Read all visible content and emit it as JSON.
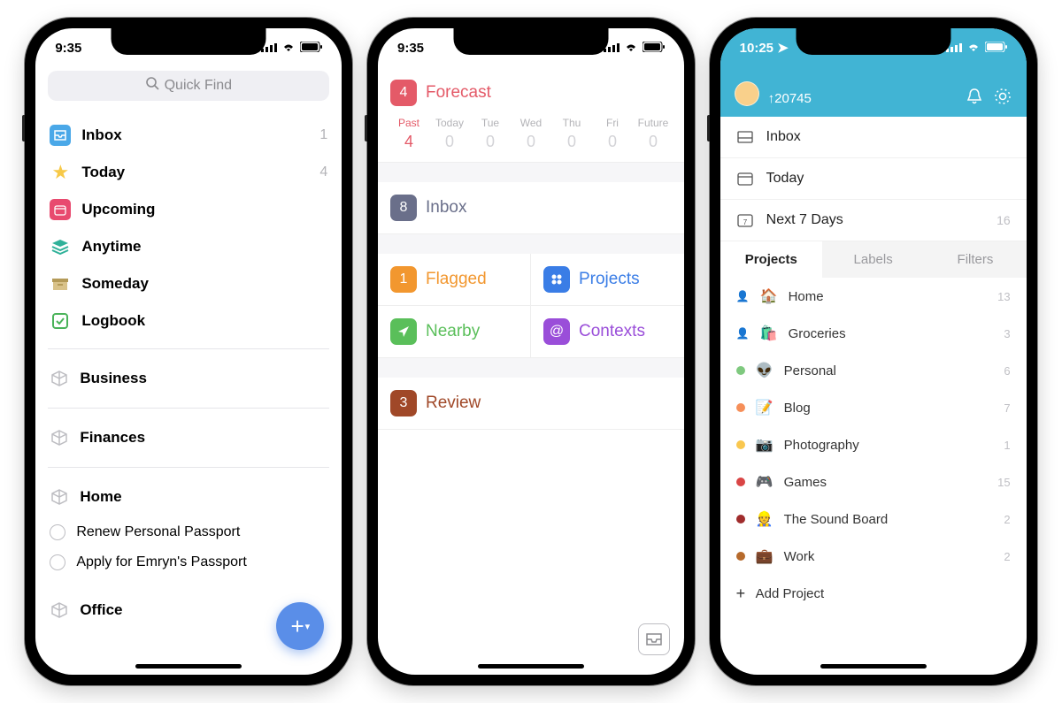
{
  "phone1": {
    "status_time": "9:35",
    "search_placeholder": "Quick Find",
    "nav": [
      {
        "icon": "inbox",
        "label": "Inbox",
        "count": "1"
      },
      {
        "icon": "star",
        "label": "Today",
        "count": "4"
      },
      {
        "icon": "calendar",
        "label": "Upcoming"
      },
      {
        "icon": "layers",
        "label": "Anytime"
      },
      {
        "icon": "archive",
        "label": "Someday"
      },
      {
        "icon": "logbook",
        "label": "Logbook"
      }
    ],
    "areas": [
      {
        "name": "Business"
      },
      {
        "name": "Finances"
      },
      {
        "name": "Home",
        "tasks": [
          "Renew Personal Passport",
          "Apply for Emryn's Passport"
        ]
      },
      {
        "name": "Office"
      }
    ]
  },
  "phone2": {
    "status_time": "9:35",
    "forecast": {
      "badge": "4",
      "label": "Forecast"
    },
    "days": [
      {
        "lbl": "Past",
        "n": "4",
        "active": true
      },
      {
        "lbl": "Today",
        "n": "0"
      },
      {
        "lbl": "Tue",
        "n": "0"
      },
      {
        "lbl": "Wed",
        "n": "0"
      },
      {
        "lbl": "Thu",
        "n": "0"
      },
      {
        "lbl": "Fri",
        "n": "0"
      },
      {
        "lbl": "Future",
        "n": "0"
      }
    ],
    "inbox": {
      "badge": "8",
      "label": "Inbox"
    },
    "tiles": [
      {
        "badge": "1",
        "label": "Flagged",
        "color": "#f2972f",
        "text": "#f2972f",
        "icon": "num"
      },
      {
        "label": "Projects",
        "color": "#3a7de6",
        "text": "#3a7de6",
        "icon": "grid"
      },
      {
        "label": "Nearby",
        "color": "#5abf5a",
        "text": "#5abf5a",
        "icon": "nav"
      },
      {
        "label": "Contexts",
        "color": "#9a4ed9",
        "text": "#9a4ed9",
        "icon": "at"
      }
    ],
    "review": {
      "badge": "3",
      "label": "Review"
    }
  },
  "phone3": {
    "status_time": "10:25",
    "score": "20745",
    "nav": [
      {
        "icon": "inbox",
        "label": "Inbox"
      },
      {
        "icon": "today",
        "label": "Today"
      },
      {
        "icon": "week",
        "label": "Next 7 Days",
        "count": "16"
      }
    ],
    "tabs": [
      "Projects",
      "Labels",
      "Filters"
    ],
    "projects": [
      {
        "dot": "#7fc97f",
        "emoji": "🏠",
        "label": "Home",
        "count": "13",
        "share": true
      },
      {
        "dot": "#f68f59",
        "emoji": "🛍️",
        "label": "Groceries",
        "count": "3",
        "share": true
      },
      {
        "dot": "#7fc97f",
        "emoji": "👽",
        "label": "Personal",
        "count": "6"
      },
      {
        "dot": "#f68f59",
        "emoji": "📝",
        "label": "Blog",
        "count": "7"
      },
      {
        "dot": "#f9c74f",
        "emoji": "📷",
        "label": "Photography",
        "count": "1"
      },
      {
        "dot": "#d94545",
        "emoji": "🎮",
        "label": "Games",
        "count": "15"
      },
      {
        "dot": "#a02c2c",
        "emoji": "👷",
        "label": "The Sound Board",
        "count": "2"
      },
      {
        "dot": "#b66a2c",
        "emoji": "💼",
        "label": "Work",
        "count": "2"
      }
    ],
    "add_project": "Add Project"
  }
}
